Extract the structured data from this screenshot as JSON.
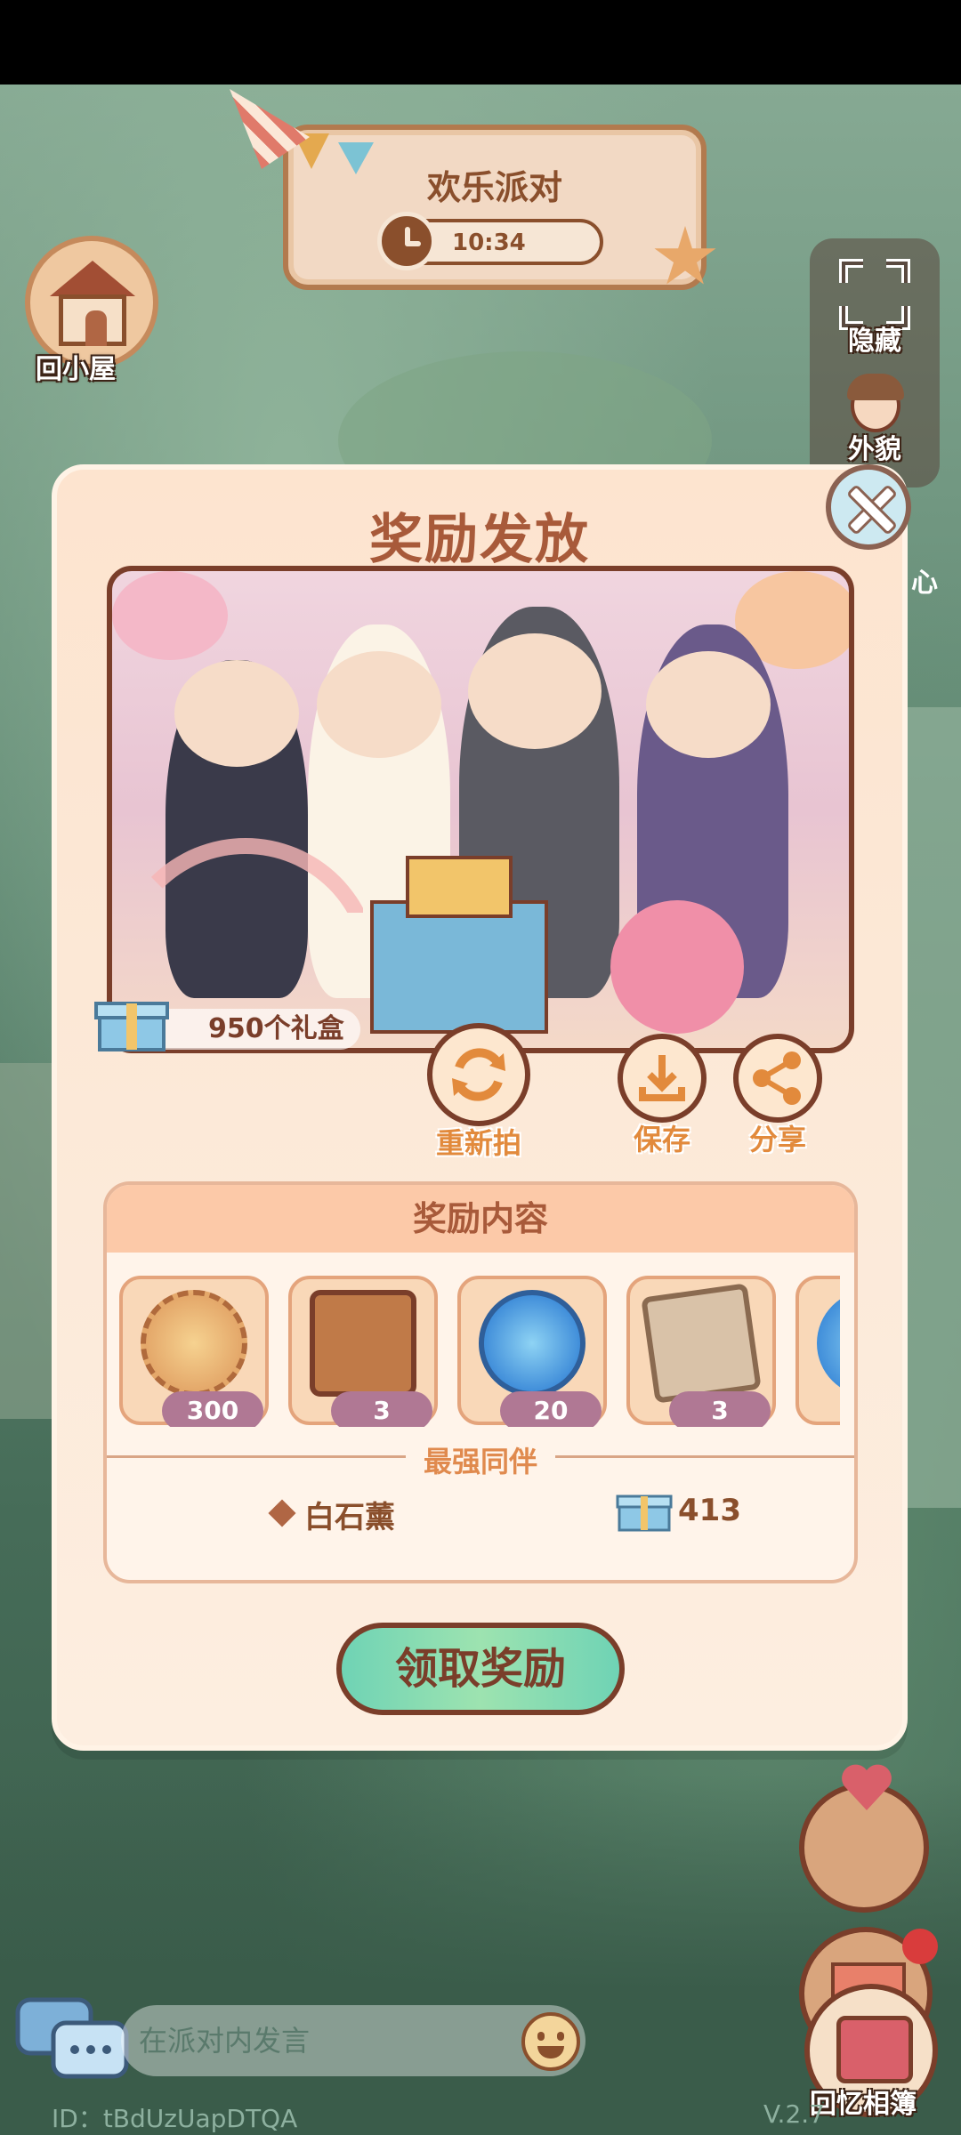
{
  "hud": {
    "party_title": "欢乐派对",
    "timer": "10:34",
    "home_label": "回小屋",
    "hide_label": "隐藏",
    "appearance_label": "外貌",
    "right_edge_text": "心"
  },
  "modal": {
    "title": "奖励发放",
    "gift_count": "950个礼盒",
    "actions": {
      "retake": "重新拍",
      "save": "保存",
      "share": "分享"
    },
    "rewards": {
      "header": "奖励内容",
      "items": [
        {
          "icon": "golden-leaf-coin-icon",
          "count": "300"
        },
        {
          "icon": "brown-book-icon",
          "count": "3"
        },
        {
          "icon": "blue-swirl-orb-icon",
          "count": "20"
        },
        {
          "icon": "scroll-map-icon",
          "count": "3"
        }
      ],
      "companion_title": "最强同伴",
      "companion_name": "白石薰",
      "companion_gifts": "413"
    },
    "claim_button": "领取奖励"
  },
  "bottom": {
    "chat_placeholder": "在派对内发言",
    "user_id": "ID：tBdUzUapDTQA",
    "version": "V.2.7",
    "memory_label": "回忆相簿"
  },
  "colors": {
    "accent_brown": "#7a3e2a",
    "title_brown": "#a85a3a",
    "claim_green": "#6fd3b5",
    "count_badge": "#b07894"
  }
}
